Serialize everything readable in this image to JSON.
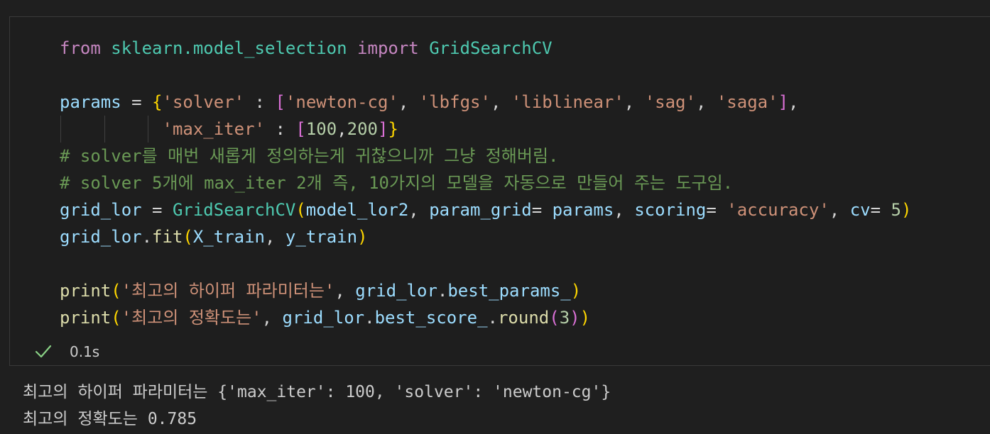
{
  "cell": {
    "code": {
      "import_from": "from",
      "import_module": "sklearn.model_selection",
      "import_kw": "import",
      "import_name": "GridSearchCV",
      "params_var": "params",
      "params_eq": " = ",
      "brace_open": "{",
      "solver_key": "'solver'",
      "colon1": " : ",
      "list_open": "[",
      "solver_values": [
        "'newton-cg'",
        "'lbfgs'",
        "'liblinear'",
        "'sag'",
        "'saga'"
      ],
      "list_close": "]",
      "trail_comma": ",",
      "max_iter_key": "'max_iter'",
      "max_iter_list_values": [
        "100",
        "200"
      ],
      "brace_close": "}",
      "comment1": "# solver를 매번 새롭게 정의하는게 귀찮으니까 그냥 정해버림.",
      "comment2": "# solver 5개에 max_iter 2개 즉, 10가지의 모델을 자동으로 만들어 주는 도구임.",
      "grid_var": "grid_lor",
      "gs_call": "GridSearchCV",
      "model_arg": "model_lor2",
      "param_grid_kw": "param_grid",
      "params_arg": "params",
      "scoring_kw": "scoring",
      "scoring_val": "'accuracy'",
      "cv_kw": "cv",
      "cv_val": "5",
      "fit_obj": "grid_lor",
      "fit_fn": "fit",
      "x_train": "X_train",
      "y_train": "y_train",
      "print_fn": "print",
      "print1_str": "'최고의 하이퍼 파라미터는'",
      "print1_obj": "grid_lor",
      "print1_attr": "best_params_",
      "print2_str": "'최고의 정확도는'",
      "print2_obj": "grid_lor",
      "print2_attr": "best_score_",
      "round_fn": "round",
      "round_arg": "3"
    },
    "status": {
      "icon": "check-icon",
      "icon_color": "#89d185",
      "exec_time": "0.1s"
    }
  },
  "output": {
    "lines": [
      "최고의 하이퍼 파라미터는 {'max_iter': 100, 'solver': 'newton-cg'}",
      "최고의 정확도는 0.785"
    ]
  }
}
